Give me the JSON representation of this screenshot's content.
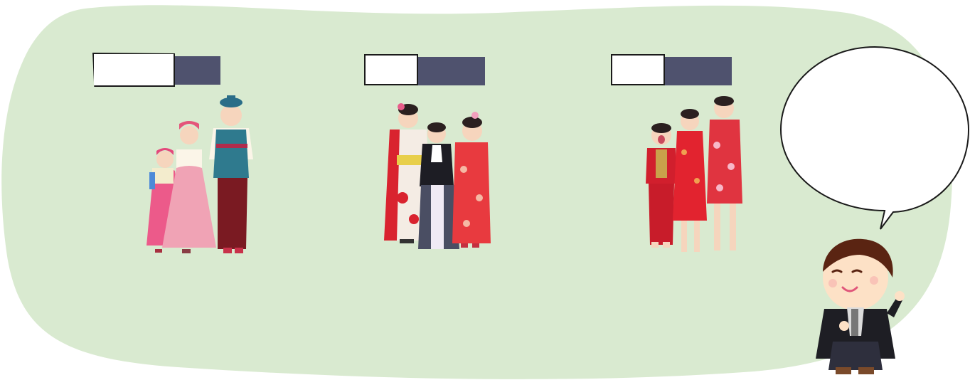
{
  "groups": [
    {
      "id": "korean",
      "label_left": "",
      "label_right": ""
    },
    {
      "id": "japanese",
      "label_left": "",
      "label_right": ""
    },
    {
      "id": "chinese",
      "label_left": "",
      "label_right": ""
    }
  ],
  "speech_bubble": {
    "text": ""
  },
  "icons": {
    "group1": "children-in-hanbok-illustration",
    "group2": "children-in-kimono-illustration",
    "group3": "children-in-qipao-illustration",
    "guide": "boy-in-hakama-waving-illustration"
  },
  "colors": {
    "background_blob": "#d9ead0",
    "label_dark": "#4f526e"
  }
}
